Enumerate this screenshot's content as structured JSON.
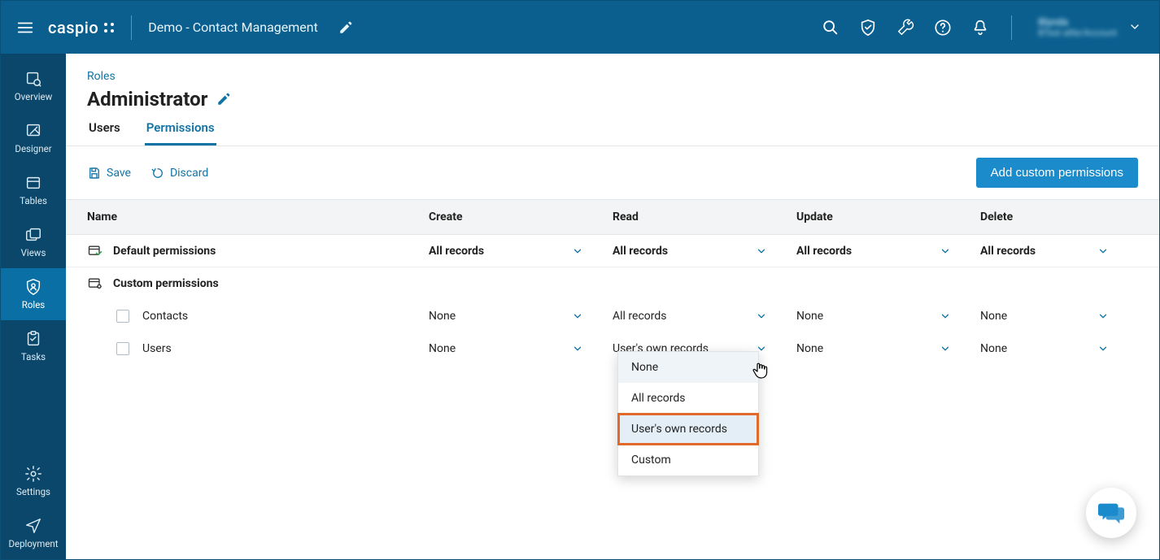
{
  "header": {
    "logo": "caspio",
    "app_name": "Demo - Contact Management",
    "user_line1": "Blynda",
    "user_line2": "BTest allte/Account"
  },
  "sidebar": {
    "items": [
      {
        "label": "Overview"
      },
      {
        "label": "Designer"
      },
      {
        "label": "Tables"
      },
      {
        "label": "Views"
      },
      {
        "label": "Roles"
      },
      {
        "label": "Tasks"
      }
    ],
    "bottom": [
      {
        "label": "Settings"
      },
      {
        "label": "Deployment"
      }
    ]
  },
  "crumb": "Roles",
  "page_title": "Administrator",
  "tabs": [
    {
      "label": "Users",
      "active": false
    },
    {
      "label": "Permissions",
      "active": true
    }
  ],
  "actions": {
    "save": "Save",
    "discard": "Discard",
    "add_custom": "Add custom permissions"
  },
  "columns": {
    "name": "Name",
    "create": "Create",
    "read": "Read",
    "update": "Update",
    "delete": "Delete"
  },
  "sections": {
    "default": "Default permissions",
    "custom": "Custom permissions"
  },
  "default_row": {
    "create": "All records",
    "read": "All records",
    "update": "All records",
    "delete": "All records"
  },
  "custom_rows": [
    {
      "name": "Contacts",
      "create": "None",
      "read": "All records",
      "update": "None",
      "delete": "None"
    },
    {
      "name": "Users",
      "create": "None",
      "read": "User's own records",
      "update": "None",
      "delete": "None"
    }
  ],
  "dropdown": {
    "options": [
      "None",
      "All records",
      "User's own records",
      "Custom"
    ],
    "hover_index": 0,
    "selected_index": 2
  }
}
